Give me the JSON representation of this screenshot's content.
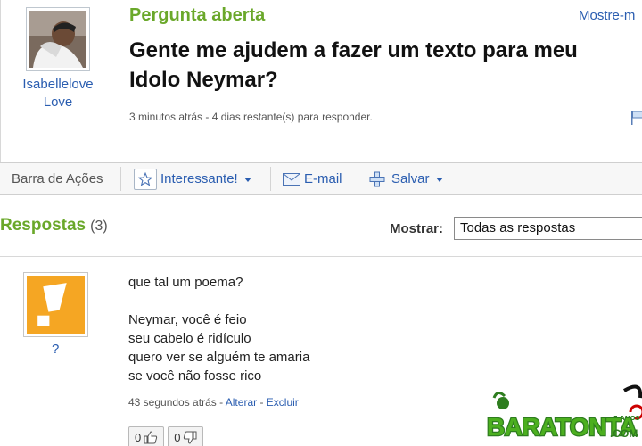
{
  "question": {
    "status": "Pergunta aberta",
    "show_more": "Mostre-m",
    "title_line1": "Gente me ajudem a fazer um texto para meu",
    "title_line2": "Idolo Neymar?",
    "meta": "3 minutos atrás - 4 dias restante(s) para responder.",
    "asker": {
      "name_line1": "Isabellelove",
      "name_line2": "Love"
    }
  },
  "actions_bar": {
    "label": "Barra de Ações",
    "interesting": "Interessante!",
    "email": "E-mail",
    "save": "Salvar"
  },
  "answers": {
    "title": "Respostas",
    "count": "(3)",
    "show_label": "Mostrar:",
    "show_value": "Todas as respostas",
    "items": [
      {
        "author": "?",
        "lines": [
          "que tal um poema?",
          "",
          "Neymar, você é feio",
          "seu cabelo é ridículo",
          "quero ver se alguém te amaria",
          "se você não fosse rico"
        ],
        "time": "43 segundos atrás",
        "edit": "Alterar",
        "delete": "Excluir",
        "thumbs_up": "0",
        "thumbs_down": "0"
      }
    ]
  },
  "watermark": {
    "brand": "BARATONTA",
    "domain": ".COM",
    "badge": "5 ANOS"
  },
  "colors": {
    "accent_green": "#6aa82a",
    "link_blue": "#2a5db0",
    "avatar_orange": "#f5a623"
  }
}
